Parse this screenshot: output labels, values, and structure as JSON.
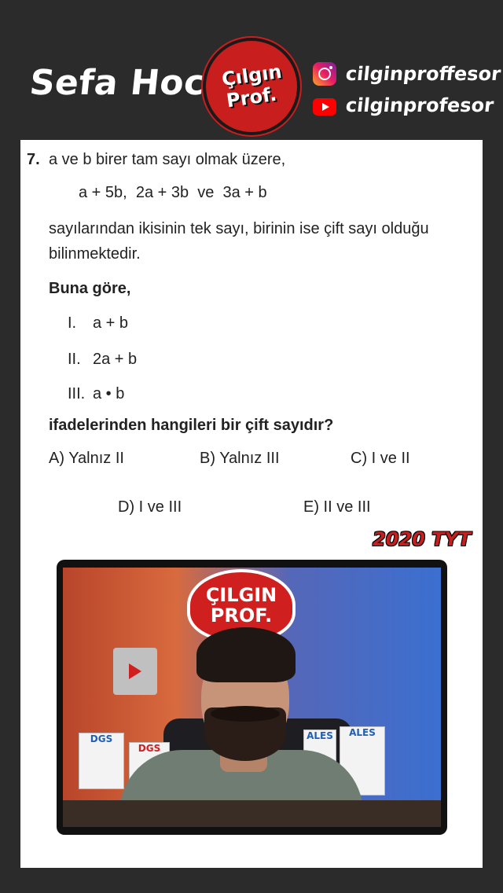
{
  "header": {
    "teacher_name": "Sefa Hoca",
    "logo_line1": "Çılgın",
    "logo_line2": "Prof.",
    "instagram_handle": "cilginproffesor",
    "youtube_handle": "cilginprofesor"
  },
  "question": {
    "number": "7.",
    "intro": "a ve b birer tam sayı olmak üzere,",
    "expression": "a + 5b,  2a + 3b  ve  3a + b",
    "body_line1": "sayılarından ikisinin tek sayı, birinin ise çift sayı olduğu",
    "body_line2": "bilinmektedir.",
    "buna_gore": "Buna göre,",
    "items": [
      {
        "num": "I.",
        "value": "a + b"
      },
      {
        "num": "II.",
        "value": "2a + b"
      },
      {
        "num": "III.",
        "value": "a • b"
      }
    ],
    "ask": "ifadelerinden hangileri bir çift sayıdır?",
    "options": {
      "A": "A) Yalnız II",
      "B": "B) Yalnız III",
      "C": "C) I ve II",
      "D": "D) I ve III",
      "E": "E) II ve III"
    },
    "year_tag": "2020 TYT"
  },
  "video": {
    "logo_line1": "ÇILGIN",
    "logo_line2": "PROF.",
    "book_left1": "DGS",
    "book_left2": "DGS",
    "book_right1": "ALES",
    "book_right2": "ALES"
  },
  "colors": {
    "background": "#2b2b2b",
    "brand_red": "#c81e1e",
    "paper": "#ffffff"
  }
}
